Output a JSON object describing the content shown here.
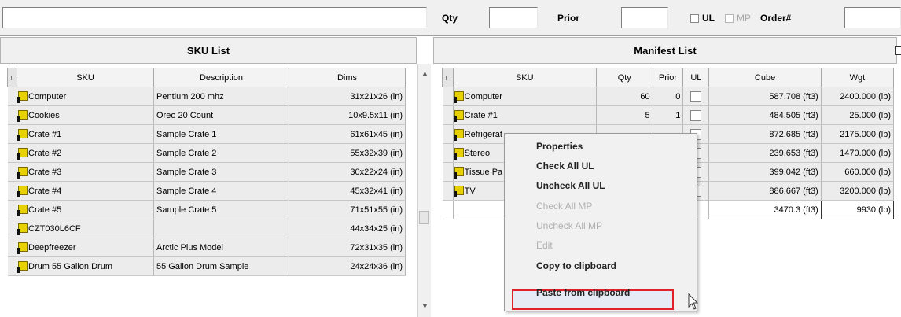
{
  "toolbar": {
    "search_value": "",
    "qty_label": "Qty",
    "qty_value": "",
    "prior_label": "Prior",
    "prior_value": "",
    "ul_label": "UL",
    "mp_label": "MP",
    "order_label": "Order#",
    "order_value": ""
  },
  "sku_list": {
    "title": "SKU List",
    "columns": [
      "SKU",
      "Description",
      "Dims"
    ],
    "rows": [
      {
        "sku": "Computer",
        "description": "Pentium 200 mhz",
        "dims": "31x21x26 (in)"
      },
      {
        "sku": "Cookies",
        "description": "Oreo 20 Count",
        "dims": "10x9.5x11 (in)"
      },
      {
        "sku": "Crate #1",
        "description": "Sample Crate 1",
        "dims": "61x61x45 (in)"
      },
      {
        "sku": "Crate #2",
        "description": "Sample Crate 2",
        "dims": "55x32x39 (in)"
      },
      {
        "sku": "Crate #3",
        "description": "Sample Crate 3",
        "dims": "30x22x24 (in)"
      },
      {
        "sku": "Crate #4",
        "description": "Sample Crate 4",
        "dims": "45x32x41 (in)"
      },
      {
        "sku": "Crate #5",
        "description": "Sample Crate 5",
        "dims": "71x51x55 (in)"
      },
      {
        "sku": "CZT030L6CF",
        "description": "",
        "dims": "44x34x25 (in)"
      },
      {
        "sku": "Deepfreezer",
        "description": "Arctic Plus Model",
        "dims": "72x31x35 (in)"
      },
      {
        "sku": "Drum 55 Gallon Drum",
        "description": "55 Gallon Drum Sample",
        "dims": "24x24x36 (in)"
      }
    ]
  },
  "manifest_list": {
    "title": "Manifest List",
    "columns": [
      "SKU",
      "Qty",
      "Prior",
      "UL",
      "Cube",
      "Wgt"
    ],
    "rows": [
      {
        "sku": "Computer",
        "qty": "60",
        "prior": "0",
        "cube": "587.708 (ft3)",
        "wgt": "2400.000 (lb)"
      },
      {
        "sku": "Crate #1",
        "qty": "5",
        "prior": "1",
        "cube": "484.505 (ft3)",
        "wgt": "25.000 (lb)"
      },
      {
        "sku": "Refrigerat",
        "qty": "",
        "prior": "",
        "cube": "872.685 (ft3)",
        "wgt": "2175.000 (lb)"
      },
      {
        "sku": "Stereo",
        "qty": "",
        "prior": "",
        "cube": "239.653 (ft3)",
        "wgt": "1470.000 (lb)"
      },
      {
        "sku": "Tissue Pa",
        "qty": "",
        "prior": "",
        "cube": "399.042 (ft3)",
        "wgt": "660.000 (lb)"
      },
      {
        "sku": "TV",
        "qty": "",
        "prior": "",
        "cube": "886.667 (ft3)",
        "wgt": "3200.000 (lb)"
      }
    ],
    "totals": {
      "cube": "3470.3 (ft3)",
      "wgt": "9930 (lb)"
    }
  },
  "context_menu": {
    "items": [
      {
        "label": "Properties",
        "enabled": true
      },
      {
        "label": "Check All UL",
        "enabled": true
      },
      {
        "label": "Uncheck All UL",
        "enabled": true
      },
      {
        "label": "Check All MP",
        "enabled": false
      },
      {
        "label": "Uncheck All MP",
        "enabled": false
      },
      {
        "label": "Edit",
        "enabled": false
      },
      {
        "label": "Copy to clipboard",
        "enabled": true
      },
      {
        "label": "Paste from clipboard",
        "enabled": true,
        "highlighted": true
      }
    ]
  },
  "colors": {
    "highlight_border": "#e0202a",
    "row_indicator": "#e8d100"
  }
}
